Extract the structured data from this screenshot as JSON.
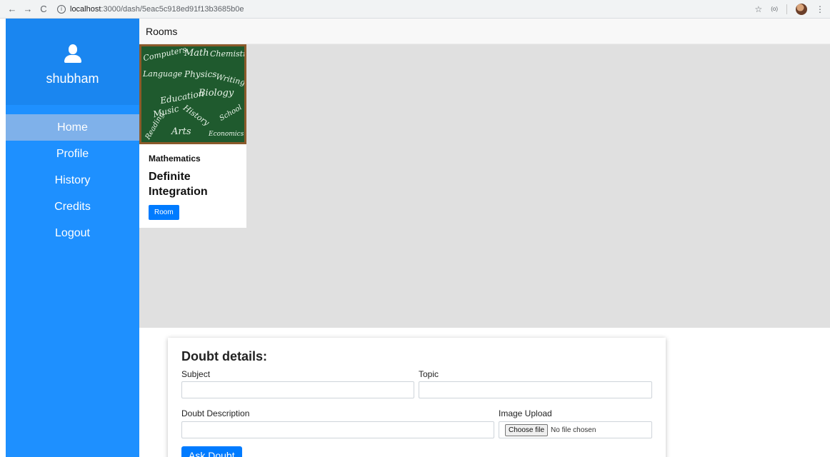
{
  "browser": {
    "url_host": "localhost",
    "url_path": ":3000/dash/5eac5c918ed91f13b3685b0e",
    "back": "←",
    "forward": "→",
    "reload": "C",
    "star": "☆",
    "cast": "(o)",
    "menu": "⋮"
  },
  "sidebar": {
    "username": "shubham",
    "items": [
      {
        "label": "Home",
        "active": true
      },
      {
        "label": "Profile"
      },
      {
        "label": "History"
      },
      {
        "label": "Credits"
      },
      {
        "label": "Logout"
      }
    ]
  },
  "topbar": {
    "title": "Rooms"
  },
  "room_card": {
    "chalk_words": [
      "Computers",
      "Math",
      "Chemistry",
      "Language",
      "Physics",
      "Writing",
      "Biology",
      "Education",
      "Music",
      "History",
      "School",
      "Arts",
      "Economics",
      "Reading"
    ],
    "subject": "Mathematics",
    "topic": "Definite Integration",
    "button": "Room"
  },
  "doubt_form": {
    "title": "Doubt details:",
    "subject_label": "Subject",
    "topic_label": "Topic",
    "description_label": "Doubt Description",
    "image_label": "Image Upload",
    "choose_file": "Choose file",
    "no_file": "No file chosen",
    "submit": "Ask Doubt"
  },
  "colors": {
    "sidebar": "#1e90ff",
    "active_item": "#7fb1ea",
    "button": "#007bff",
    "rooms_bg": "#e0e0e0"
  }
}
